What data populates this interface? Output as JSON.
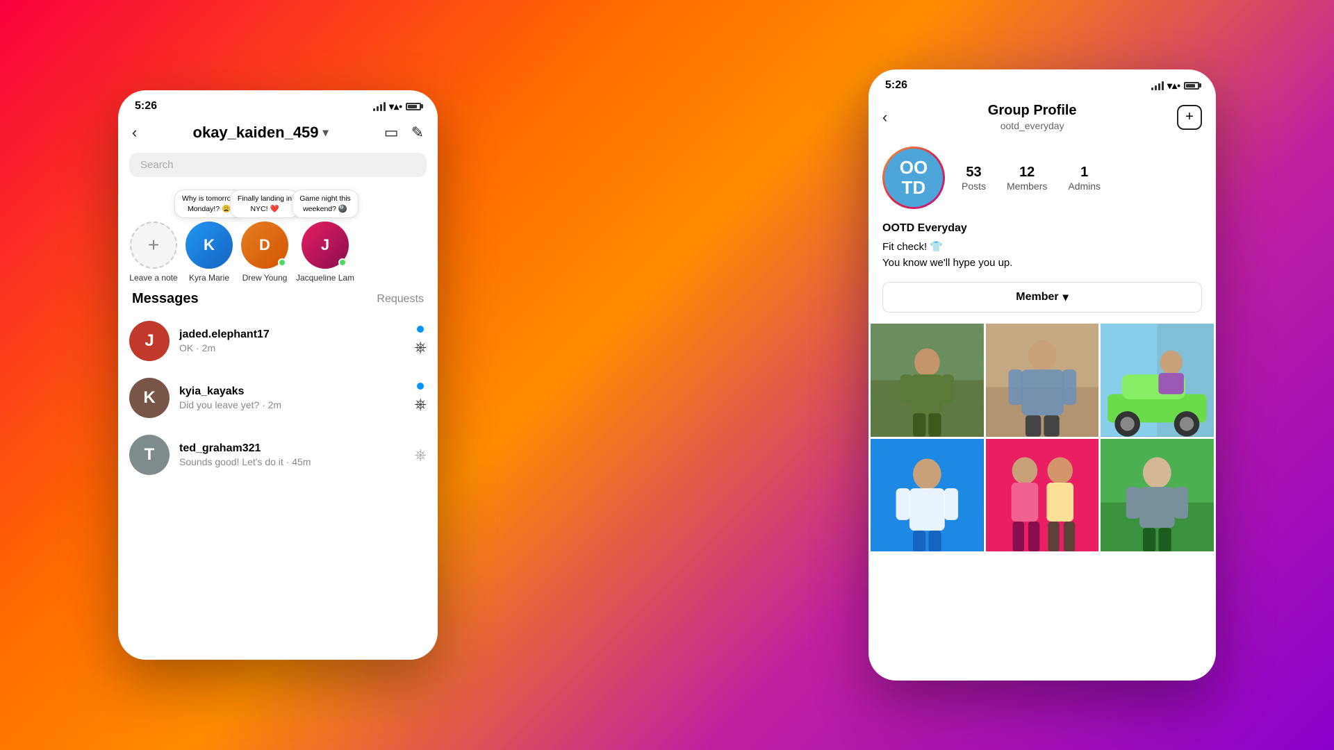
{
  "background": {
    "gradient": "135deg, #f9003e, #ff6a00, #ff8c00, #c020a0, #8b00cc"
  },
  "left_phone": {
    "status_bar": {
      "time": "5:26"
    },
    "nav": {
      "back_icon": "‹",
      "title": "okay_kaiden_459",
      "chevron": "⌄",
      "video_icon": "□",
      "edit_icon": "✏"
    },
    "search_placeholder": "Search",
    "notes": [
      {
        "name": "Leave a note",
        "type": "add"
      },
      {
        "name": "Kyra Marie",
        "bubble": "Why is tomorrow Monday!? 😩",
        "online": false
      },
      {
        "name": "Drew Young",
        "bubble": "Finally landing in NYC! ❤️",
        "online": true
      },
      {
        "name": "Jacqueline Lam",
        "bubble": "Game night this weekend? 🎱",
        "online": true
      }
    ],
    "messages_section": {
      "title": "Messages",
      "requests_label": "Requests",
      "items": [
        {
          "username": "jaded.elephant17",
          "preview": "OK · 2m",
          "unread": true
        },
        {
          "username": "kyia_kayaks",
          "preview": "Did you leave yet? · 2m",
          "unread": true
        },
        {
          "username": "ted_graham321",
          "preview": "Sounds good! Let's do it · 45m",
          "unread": false
        }
      ]
    }
  },
  "right_phone": {
    "status_bar": {
      "time": "5:26"
    },
    "header": {
      "back_icon": "‹",
      "title": "Group Profile",
      "subtitle": "ootd_everyday",
      "add_icon": "+"
    },
    "group": {
      "initials": "OO\nTD",
      "name": "OOTD Everyday",
      "bio_line1": "Fit check! 👕",
      "bio_line2": "You know we'll hype you up.",
      "stats": [
        {
          "num": "53",
          "label": "Posts"
        },
        {
          "num": "12",
          "label": "Members"
        },
        {
          "num": "1",
          "label": "Admins"
        }
      ],
      "member_button": "Member ⌄"
    },
    "photos": [
      {
        "type": "outdoor_person"
      },
      {
        "type": "fashion_person"
      },
      {
        "type": "colorful_person"
      },
      {
        "type": "blue_person"
      },
      {
        "type": "pink_couple"
      },
      {
        "type": "green_person"
      }
    ]
  }
}
